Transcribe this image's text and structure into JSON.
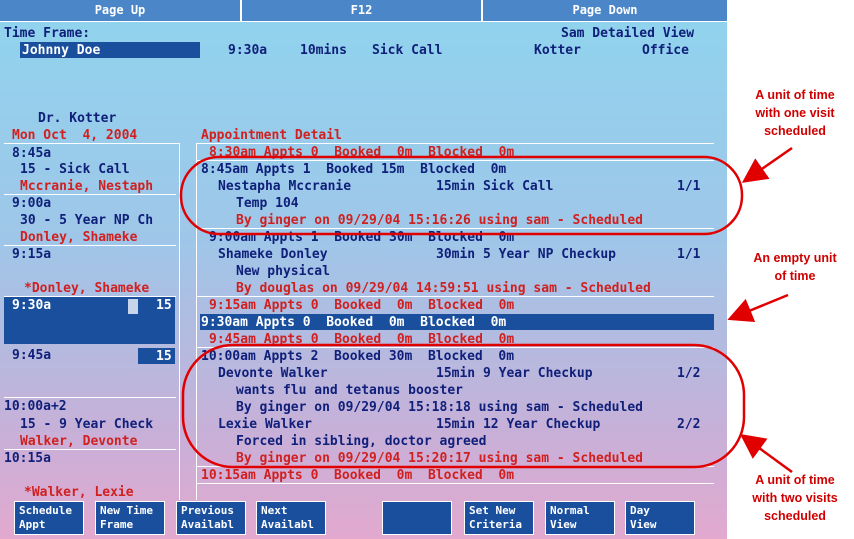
{
  "topbar": {
    "page_up": "Page Up",
    "f12": "F12",
    "page_down": "Page Down"
  },
  "header": {
    "time_frame_label": "Time Frame:",
    "view_title": "Sam Detailed View",
    "patient": "Johnny Doe",
    "time": "9:30a",
    "duration": "10mins",
    "reason": "Sick Call",
    "provider": "Kotter",
    "location": "Office"
  },
  "left": {
    "doctor": "Dr. Kotter",
    "date": "Mon Oct  4, 2004",
    "slot1": {
      "time": "8:45a",
      "line1": "15 - Sick Call",
      "patient": "Mccranie, Nestaph"
    },
    "slot2": {
      "time": "9:00a",
      "line1": "30 - 5 Year NP Ch",
      "patient": "Donley, Shameke"
    },
    "slot3": {
      "time": "9:15a",
      "extra": "*Donley, Shameke"
    },
    "slot4": {
      "time": "9:30a",
      "num": "15"
    },
    "slot5": {
      "time": "9:45a",
      "num": "15"
    },
    "slot6": {
      "time": "10:00a+2",
      "line1": "15 - 9 Year Check",
      "patient": "Walker, Devonte"
    },
    "slot7": {
      "time": "10:15a",
      "extra": "*Walker, Lexie"
    }
  },
  "detail": {
    "heading": "Appointment Detail",
    "r830": "8:30am Appts 0  Booked  0m  Blocked  0m",
    "r845": "8:45am Appts 1  Booked 15m  Blocked  0m",
    "r845_patient": "Nestapha Mccranie",
    "r845_visit": "15min Sick Call",
    "r845_count": "1/1",
    "r845_note": "Temp 104",
    "r845_by": "By ginger on 09/29/04 15:16:26 using sam - Scheduled",
    "r900": "9:00am Appts 1  Booked 30m  Blocked  0m",
    "r900_patient": "Shameke Donley",
    "r900_visit": "30min 5 Year NP Checkup",
    "r900_count": "1/1",
    "r900_note": "New physical",
    "r900_by": "By douglas on 09/29/04 14:59:51 using sam - Scheduled",
    "r915": "9:15am Appts 0  Booked  0m  Blocked  0m",
    "r930": "9:30am Appts 0  Booked  0m  Blocked  0m",
    "r945": "9:45am Appts 0  Booked  0m  Blocked  0m",
    "r1000": "10:00am Appts 2  Booked 30m  Blocked  0m",
    "r1000_p1": "Devonte Walker",
    "r1000_v1": "15min 9 Year Checkup",
    "r1000_c1": "1/2",
    "r1000_n1": "wants flu and tetanus booster",
    "r1000_by1": "By ginger on 09/29/04 15:18:18 using sam - Scheduled",
    "r1000_p2": "Lexie Walker",
    "r1000_v2": "15min 12 Year Checkup",
    "r1000_c2": "2/2",
    "r1000_n2": "Forced in sibling, doctor agreed",
    "r1000_by2": "By ginger on 09/29/04 15:20:17 using sam - Scheduled",
    "r1015": "10:15am Appts 0  Booked  0m  Blocked  0m"
  },
  "buttons": {
    "b1a": "Schedule",
    "b1b": "Appt",
    "b2a": "New Time",
    "b2b": "Frame",
    "b3a": "Previous",
    "b3b": "Availabl",
    "b4a": "Next",
    "b4b": "Availabl",
    "b6a": "Set New",
    "b6b": "Criteria",
    "b7a": "Normal",
    "b7b": "View",
    "b8a": "Day",
    "b8b": "View"
  },
  "annotations": {
    "one_visit": [
      "A unit of time",
      "with one visit",
      "scheduled"
    ],
    "empty": [
      "An empty unit",
      "of time"
    ],
    "two_visits": [
      "A unit of time",
      "with two visits",
      "scheduled"
    ]
  },
  "colors": {
    "navy": "#10207a",
    "red": "#d02020",
    "selection": "#1a4f9e",
    "annotation": "#d00000"
  }
}
